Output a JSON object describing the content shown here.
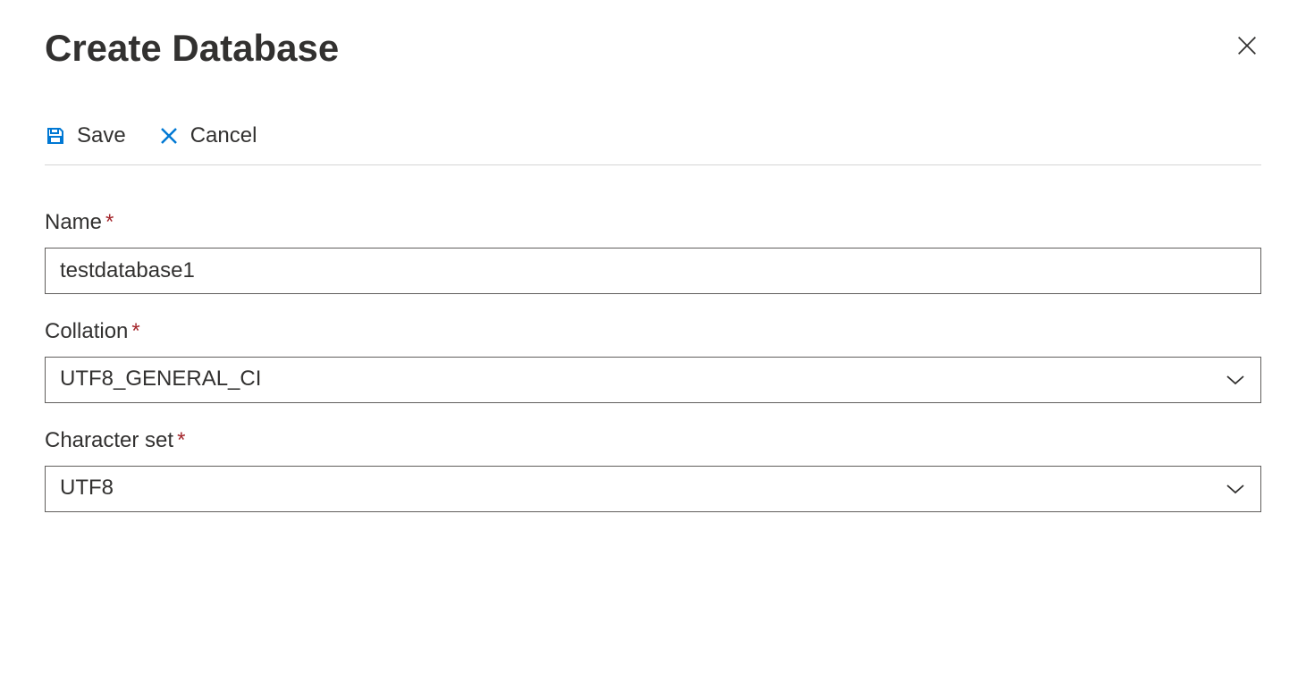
{
  "header": {
    "title": "Create Database"
  },
  "toolbar": {
    "save_label": "Save",
    "cancel_label": "Cancel"
  },
  "form": {
    "name": {
      "label": "Name",
      "value": "testdatabase1"
    },
    "collation": {
      "label": "Collation",
      "value": "UTF8_GENERAL_CI"
    },
    "charset": {
      "label": "Character set",
      "value": "UTF8"
    }
  }
}
